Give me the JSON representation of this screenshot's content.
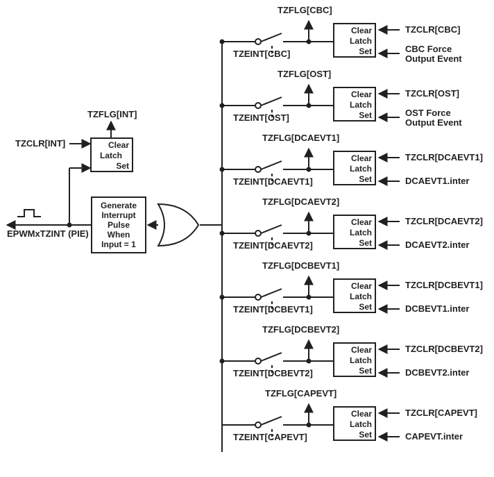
{
  "diagram": {
    "output_signal": "EPWMxTZINT (PIE)",
    "int_latch": {
      "clear_input_label": "TZCLR[INT]",
      "flag_output_label": "TZFLG[INT]",
      "box": {
        "clear": "Clear",
        "mid": "Latch",
        "set": "Set"
      }
    },
    "pulse_box": {
      "l1": "Generate",
      "l2": "Interrupt",
      "l3": "Pulse",
      "l4": "When",
      "l5": "Input = 1"
    },
    "channels": [
      {
        "key": "CBC",
        "flag": "TZFLG[CBC]",
        "enable": "TZEINT[CBC]",
        "clear_in": "TZCLR[CBC]",
        "set_in_l1": "CBC Force",
        "set_in_l2": "Output Event",
        "box": {
          "clear": "Clear",
          "mid": "Latch",
          "set": "Set"
        }
      },
      {
        "key": "OST",
        "flag": "TZFLG[OST]",
        "enable": "TZEINT[OST]",
        "clear_in": "TZCLR[OST]",
        "set_in_l1": "OST Force",
        "set_in_l2": "Output Event",
        "box": {
          "clear": "Clear",
          "mid": "Latch",
          "set": "Set"
        }
      },
      {
        "key": "DCAEVT1",
        "flag": "TZFLG[DCAEVT1]",
        "enable": "TZEINT[DCAEVT1]",
        "clear_in": "TZCLR[DCAEVT1]",
        "set_in_l1": "DCAEVT1.inter",
        "set_in_l2": "",
        "box": {
          "clear": "Clear",
          "mid": "Latch",
          "set": "Set"
        }
      },
      {
        "key": "DCAEVT2",
        "flag": "TZFLG[DCAEVT2]",
        "enable": "TZEINT[DCAEVT2]",
        "clear_in": "TZCLR[DCAEVT2]",
        "set_in_l1": "DCAEVT2.inter",
        "set_in_l2": "",
        "box": {
          "clear": "Clear",
          "mid": "Latch",
          "set": "Set"
        }
      },
      {
        "key": "DCBEVT1",
        "flag": "TZFLG[DCBEVT1]",
        "enable": "TZEINT[DCBEVT1]",
        "clear_in": "TZCLR[DCBEVT1]",
        "set_in_l1": "DCBEVT1.inter",
        "set_in_l2": "",
        "box": {
          "clear": "Clear",
          "mid": "Latch",
          "set": "Set"
        }
      },
      {
        "key": "DCBEVT2",
        "flag": "TZFLG[DCBEVT2]",
        "enable": "TZEINT[DCBEVT2]",
        "clear_in": "TZCLR[DCBEVT2]",
        "set_in_l1": "DCBEVT2.inter",
        "set_in_l2": "",
        "box": {
          "clear": "Clear",
          "mid": "Latch",
          "set": "Set"
        }
      },
      {
        "key": "CAPEVT",
        "flag": "TZFLG[CAPEVT]",
        "enable": "TZEINT[CAPEVT]",
        "clear_in": "TZCLR[CAPEVT]",
        "set_in_l1": "CAPEVT.inter",
        "set_in_l2": "",
        "box": {
          "clear": "Clear",
          "mid": "Latch",
          "set": "Set"
        }
      }
    ]
  }
}
